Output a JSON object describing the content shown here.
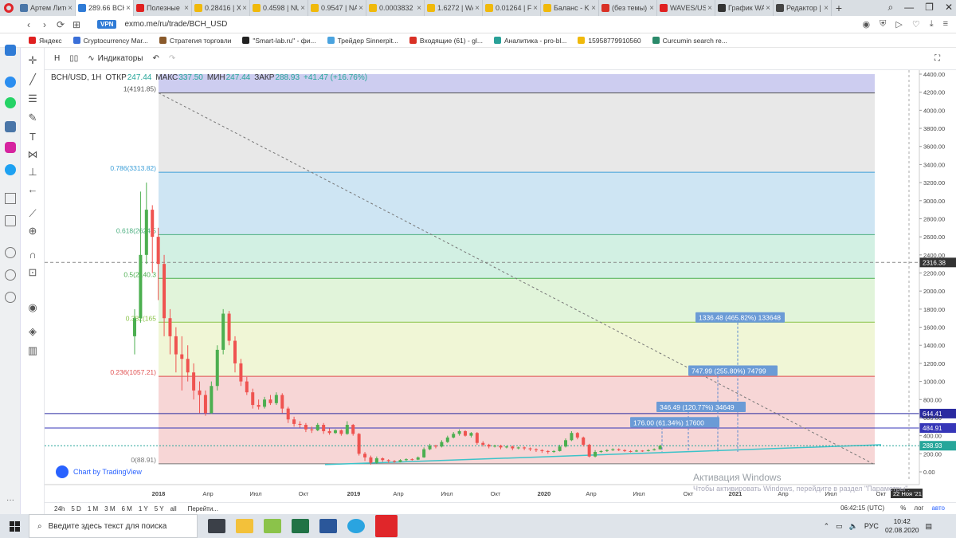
{
  "browser": {
    "tabs": [
      {
        "label": "Артем Лито",
        "color": "#4a76a8",
        "active": false
      },
      {
        "label": "289.66 BCH",
        "color": "#2f7bd6",
        "active": true
      },
      {
        "label": "Полезные",
        "color": "#e02020",
        "active": false
      },
      {
        "label": "0.28416 | XR",
        "color": "#f0b90b",
        "active": false
      },
      {
        "label": "0.4598 | NU",
        "color": "#f0b90b",
        "active": false
      },
      {
        "label": "0.9547 | NA",
        "color": "#f0b90b",
        "active": false
      },
      {
        "label": "0.0003832 |",
        "color": "#f0b90b",
        "active": false
      },
      {
        "label": "1.6272 | WA",
        "color": "#f0b90b",
        "active": false
      },
      {
        "label": "0.01264 | FI",
        "color": "#f0b90b",
        "active": false
      },
      {
        "label": "Баланс - K",
        "color": "#f0b90b",
        "active": false
      },
      {
        "label": "(без темы)",
        "color": "#d93025",
        "active": false
      },
      {
        "label": "WAVES/USC",
        "color": "#e02020",
        "active": false
      },
      {
        "label": "График WA",
        "color": "#333333",
        "active": false
      },
      {
        "label": "Редактор |",
        "color": "#444444",
        "active": false
      }
    ],
    "vpn_label": "VPN",
    "url": "exmo.me/ru/trade/BCH_USD",
    "bookmarks": [
      {
        "label": "Яндекс",
        "color": "#e02020"
      },
      {
        "label": "Cryptocurrency Mar...",
        "color": "#3a6fd8"
      },
      {
        "label": "Стратегия торговли",
        "color": "#8a5a2b"
      },
      {
        "label": "\"Smart-lab.ru\" - фи...",
        "color": "#222222"
      },
      {
        "label": "Трейдер Sinnerpit...",
        "color": "#4aa3df"
      },
      {
        "label": "Входящие (61) - gl...",
        "color": "#d93025"
      },
      {
        "label": "Аналитика - pro-bl...",
        "color": "#2aa198"
      },
      {
        "label": "15958779910560",
        "color": "#f0b90b"
      },
      {
        "label": "Curcumin search re...",
        "color": "#2a8a6a"
      }
    ]
  },
  "toolbar": {
    "interval_h": "H",
    "indicators_label": "Индикаторы"
  },
  "chart_header": {
    "symbol": "BCH/USD, 1H",
    "open_label": "ОТКР",
    "open": "247.44",
    "high_label": "МАКС",
    "high": "337.50",
    "low_label": "МИН",
    "low": "247.44",
    "close_label": "ЗАКР",
    "close": "288.93",
    "change": "+41.47 (+16.76%)"
  },
  "chart_data": {
    "type": "candlestick",
    "y_ticks": [
      "4400.00",
      "4200.00",
      "4000.00",
      "3800.00",
      "3600.00",
      "3400.00",
      "3200.00",
      "3000.00",
      "2800.00",
      "2600.00",
      "2400.00",
      "2200.00",
      "2000.00",
      "1800.00",
      "1600.00",
      "1400.00",
      "1200.00",
      "1000.00",
      "800.00",
      "600.00",
      "400.00",
      "200.00",
      "0.00"
    ],
    "x_ticks": [
      "2018",
      "Апр",
      "Июл",
      "Окт",
      "2019",
      "Апр",
      "Июл",
      "Окт",
      "2020",
      "Апр",
      "Июл",
      "Окт",
      "2021",
      "Апр",
      "Июл",
      "Окт"
    ],
    "fib_levels": [
      {
        "label": "1(4191.85)",
        "value": 4191.85,
        "color": "#555555"
      },
      {
        "label": "0.786(3313.82)",
        "value": 3313.82,
        "color": "#3d9fd8"
      },
      {
        "label": "0.618(2624.5",
        "value": 2624.5,
        "color": "#4caf80"
      },
      {
        "label": "0.5(2140.3",
        "value": 2140.3,
        "color": "#4caf50"
      },
      {
        "label": "0.382(165",
        "value": 1655,
        "color": "#8bc34a"
      },
      {
        "label": "0.236(1057.21)",
        "value": 1057.21,
        "color": "#e05050"
      },
      {
        "label": "0(88.91)",
        "value": 88.91,
        "color": "#777777"
      }
    ],
    "horizontal_lines": [
      {
        "value": 644.41,
        "label": "644.41",
        "color": "#2a2aa0"
      },
      {
        "value": 484.91,
        "label": "484.91",
        "color": "#3636b8"
      }
    ],
    "crosshair": {
      "value": 2316.38,
      "label": "2316.38"
    },
    "last_price": {
      "value": 288.93,
      "label": "288.93",
      "color": "#26a69a"
    },
    "targets": [
      {
        "text": "1336.48 (465.82%) 133648",
        "value": 1625
      },
      {
        "text": "747.99 (255.80%) 74799",
        "value": 1036
      },
      {
        "text": "346.49 (120.77%) 34649",
        "value": 635
      },
      {
        "text": "176.00 (61.34%) 17600",
        "value": 465
      }
    ],
    "time_label": "22 Ноя '21",
    "candles": [
      {
        "d": 0,
        "o": 1500,
        "c": 1700,
        "h": 1800,
        "l": 1300
      },
      {
        "d": 2,
        "o": 1700,
        "c": 2400,
        "h": 3100,
        "l": 1650
      },
      {
        "d": 4,
        "o": 2400,
        "c": 2900,
        "h": 3200,
        "l": 2300
      },
      {
        "d": 6,
        "o": 2900,
        "c": 2600,
        "h": 2950,
        "l": 2200
      },
      {
        "d": 8,
        "o": 2600,
        "c": 2300,
        "h": 2700,
        "l": 1900
      },
      {
        "d": 10,
        "o": 2300,
        "c": 1700,
        "h": 2400,
        "l": 1500
      },
      {
        "d": 12,
        "o": 1700,
        "c": 1500,
        "h": 1800,
        "l": 1300
      },
      {
        "d": 14,
        "o": 1500,
        "c": 1300,
        "h": 1600,
        "l": 1100
      },
      {
        "d": 16,
        "o": 1300,
        "c": 1250,
        "h": 1500,
        "l": 900
      },
      {
        "d": 18,
        "o": 1250,
        "c": 1100,
        "h": 1400,
        "l": 1000
      },
      {
        "d": 20,
        "o": 1100,
        "c": 900,
        "h": 1200,
        "l": 800
      },
      {
        "d": 22,
        "o": 900,
        "c": 850,
        "h": 1000,
        "l": 650
      },
      {
        "d": 24,
        "o": 850,
        "c": 650,
        "h": 900,
        "l": 620
      },
      {
        "d": 26,
        "o": 650,
        "c": 950,
        "h": 1000,
        "l": 640
      },
      {
        "d": 28,
        "o": 950,
        "c": 1350,
        "h": 1400,
        "l": 900
      },
      {
        "d": 30,
        "o": 1350,
        "c": 1750,
        "h": 1800,
        "l": 1300
      },
      {
        "d": 32,
        "o": 1750,
        "c": 1450,
        "h": 1780,
        "l": 1400
      },
      {
        "d": 34,
        "o": 1450,
        "c": 1200,
        "h": 1500,
        "l": 1100
      },
      {
        "d": 36,
        "o": 1200,
        "c": 1000,
        "h": 1250,
        "l": 950
      },
      {
        "d": 38,
        "o": 1000,
        "c": 880,
        "h": 1050,
        "l": 850
      },
      {
        "d": 40,
        "o": 880,
        "c": 740,
        "h": 920,
        "l": 700
      },
      {
        "d": 42,
        "o": 740,
        "c": 720,
        "h": 800,
        "l": 690
      },
      {
        "d": 44,
        "o": 720,
        "c": 800,
        "h": 830,
        "l": 700
      },
      {
        "d": 46,
        "o": 800,
        "c": 760,
        "h": 850,
        "l": 740
      },
      {
        "d": 48,
        "o": 760,
        "c": 850,
        "h": 880,
        "l": 740
      },
      {
        "d": 50,
        "o": 850,
        "c": 700,
        "h": 870,
        "l": 650
      },
      {
        "d": 52,
        "o": 700,
        "c": 580,
        "h": 720,
        "l": 540
      },
      {
        "d": 54,
        "o": 580,
        "c": 530,
        "h": 610,
        "l": 500
      },
      {
        "d": 56,
        "o": 530,
        "c": 520,
        "h": 560,
        "l": 490
      },
      {
        "d": 58,
        "o": 520,
        "c": 470,
        "h": 540,
        "l": 440
      },
      {
        "d": 60,
        "o": 470,
        "c": 460,
        "h": 500,
        "l": 430
      },
      {
        "d": 62,
        "o": 460,
        "c": 520,
        "h": 540,
        "l": 450
      },
      {
        "d": 64,
        "o": 520,
        "c": 450,
        "h": 540,
        "l": 420
      },
      {
        "d": 66,
        "o": 450,
        "c": 430,
        "h": 480,
        "l": 410
      },
      {
        "d": 68,
        "o": 430,
        "c": 460,
        "h": 470,
        "l": 420
      },
      {
        "d": 70,
        "o": 460,
        "c": 420,
        "h": 470,
        "l": 400
      },
      {
        "d": 72,
        "o": 420,
        "c": 520,
        "h": 560,
        "l": 410
      },
      {
        "d": 74,
        "o": 520,
        "c": 420,
        "h": 530,
        "l": 400
      },
      {
        "d": 76,
        "o": 420,
        "c": 200,
        "h": 430,
        "l": 180
      },
      {
        "d": 78,
        "o": 200,
        "c": 160,
        "h": 220,
        "l": 120
      },
      {
        "d": 80,
        "o": 160,
        "c": 100,
        "h": 180,
        "l": 80
      },
      {
        "d": 82,
        "o": 100,
        "c": 150,
        "h": 170,
        "l": 90
      },
      {
        "d": 84,
        "o": 150,
        "c": 130,
        "h": 160,
        "l": 110
      },
      {
        "d": 86,
        "o": 130,
        "c": 120,
        "h": 140,
        "l": 100
      },
      {
        "d": 88,
        "o": 120,
        "c": 110,
        "h": 130,
        "l": 100
      },
      {
        "d": 90,
        "o": 110,
        "c": 130,
        "h": 140,
        "l": 105
      },
      {
        "d": 92,
        "o": 130,
        "c": 140,
        "h": 150,
        "l": 120
      },
      {
        "d": 94,
        "o": 140,
        "c": 135,
        "h": 150,
        "l": 125
      },
      {
        "d": 96,
        "o": 135,
        "c": 160,
        "h": 170,
        "l": 130
      },
      {
        "d": 98,
        "o": 160,
        "c": 250,
        "h": 270,
        "l": 155
      },
      {
        "d": 100,
        "o": 250,
        "c": 290,
        "h": 310,
        "l": 240
      },
      {
        "d": 102,
        "o": 290,
        "c": 280,
        "h": 300,
        "l": 260
      },
      {
        "d": 104,
        "o": 280,
        "c": 330,
        "h": 350,
        "l": 270
      },
      {
        "d": 106,
        "o": 330,
        "c": 380,
        "h": 400,
        "l": 320
      },
      {
        "d": 108,
        "o": 380,
        "c": 420,
        "h": 440,
        "l": 370
      },
      {
        "d": 110,
        "o": 420,
        "c": 450,
        "h": 470,
        "l": 400
      },
      {
        "d": 112,
        "o": 450,
        "c": 400,
        "h": 460,
        "l": 390
      },
      {
        "d": 114,
        "o": 400,
        "c": 430,
        "h": 440,
        "l": 380
      },
      {
        "d": 116,
        "o": 430,
        "c": 320,
        "h": 440,
        "l": 300
      },
      {
        "d": 118,
        "o": 320,
        "c": 300,
        "h": 340,
        "l": 280
      },
      {
        "d": 120,
        "o": 300,
        "c": 280,
        "h": 310,
        "l": 260
      },
      {
        "d": 122,
        "o": 280,
        "c": 290,
        "h": 300,
        "l": 270
      },
      {
        "d": 124,
        "o": 290,
        "c": 270,
        "h": 300,
        "l": 250
      },
      {
        "d": 126,
        "o": 270,
        "c": 280,
        "h": 290,
        "l": 260
      },
      {
        "d": 128,
        "o": 280,
        "c": 260,
        "h": 290,
        "l": 240
      },
      {
        "d": 130,
        "o": 260,
        "c": 270,
        "h": 280,
        "l": 250
      },
      {
        "d": 132,
        "o": 270,
        "c": 260,
        "h": 280,
        "l": 240
      },
      {
        "d": 134,
        "o": 260,
        "c": 250,
        "h": 270,
        "l": 230
      },
      {
        "d": 136,
        "o": 250,
        "c": 240,
        "h": 260,
        "l": 220
      },
      {
        "d": 138,
        "o": 240,
        "c": 230,
        "h": 250,
        "l": 210
      },
      {
        "d": 140,
        "o": 230,
        "c": 220,
        "h": 240,
        "l": 200
      },
      {
        "d": 142,
        "o": 220,
        "c": 230,
        "h": 240,
        "l": 210
      },
      {
        "d": 144,
        "o": 230,
        "c": 280,
        "h": 300,
        "l": 225
      },
      {
        "d": 146,
        "o": 280,
        "c": 350,
        "h": 370,
        "l": 270
      },
      {
        "d": 148,
        "o": 350,
        "c": 430,
        "h": 450,
        "l": 340
      },
      {
        "d": 150,
        "o": 430,
        "c": 380,
        "h": 440,
        "l": 360
      },
      {
        "d": 152,
        "o": 380,
        "c": 300,
        "h": 390,
        "l": 280
      },
      {
        "d": 154,
        "o": 300,
        "c": 170,
        "h": 310,
        "l": 160
      },
      {
        "d": 156,
        "o": 170,
        "c": 220,
        "h": 240,
        "l": 160
      },
      {
        "d": 158,
        "o": 220,
        "c": 230,
        "h": 240,
        "l": 210
      },
      {
        "d": 160,
        "o": 230,
        "c": 240,
        "h": 250,
        "l": 220
      },
      {
        "d": 162,
        "o": 240,
        "c": 250,
        "h": 260,
        "l": 230
      },
      {
        "d": 164,
        "o": 250,
        "c": 240,
        "h": 260,
        "l": 230
      },
      {
        "d": 166,
        "o": 240,
        "c": 230,
        "h": 250,
        "l": 220
      },
      {
        "d": 168,
        "o": 230,
        "c": 225,
        "h": 240,
        "l": 215
      },
      {
        "d": 170,
        "o": 225,
        "c": 235,
        "h": 245,
        "l": 220
      },
      {
        "d": 172,
        "o": 235,
        "c": 230,
        "h": 240,
        "l": 220
      },
      {
        "d": 174,
        "o": 230,
        "c": 240,
        "h": 250,
        "l": 225
      },
      {
        "d": 176,
        "o": 240,
        "c": 250,
        "h": 260,
        "l": 235
      },
      {
        "d": 178,
        "o": 250,
        "c": 289,
        "h": 300,
        "l": 245
      }
    ]
  },
  "tv_credit": "Chart by TradingView",
  "bottom": {
    "ranges": [
      "24h",
      "5 D",
      "1 M",
      "3 M",
      "6 M",
      "1 Y",
      "5 Y",
      "all"
    ],
    "goto": "Перейти...",
    "time": "06:42:15 (UTC)",
    "percent": "%",
    "log": "лог",
    "auto": "авто"
  },
  "watermark": {
    "title": "Активация Windows",
    "subtitle": "Чтобы активировать Windows, перейдите в раздел \"Параметры\"."
  },
  "taskbar": {
    "search_placeholder": "Введите здесь текст для поиска",
    "lang": "РУС",
    "time": "10:42",
    "date": "02.08.2020"
  }
}
